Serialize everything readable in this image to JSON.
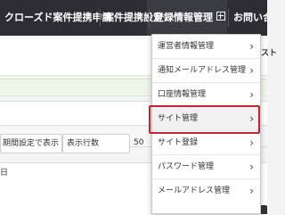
{
  "navbar": {
    "items": [
      {
        "label": "クローズド案件提携申請"
      },
      {
        "label": "案件提携設定"
      },
      {
        "label": "登録情報管理"
      },
      {
        "label": "お問い合わせ"
      }
    ]
  },
  "background": {
    "period_button": "期間設定で表示",
    "display_rows_label": "表示行数",
    "display_rows_value": "50",
    "date_suffix": "日",
    "right_tab": "スト"
  },
  "dropdown": {
    "items": [
      {
        "label": "運営者情報管理"
      },
      {
        "label": "通知メールアドレス管理"
      },
      {
        "label": "口座情報管理"
      },
      {
        "label": "サイト管理"
      },
      {
        "label": "サイト登録"
      },
      {
        "label": "パスワード管理"
      },
      {
        "label": "メールアドレス管理"
      }
    ],
    "highlighted_index": 3
  },
  "colors": {
    "navbar_bg": "#2d2d33",
    "highlight_border": "#c0262d"
  }
}
